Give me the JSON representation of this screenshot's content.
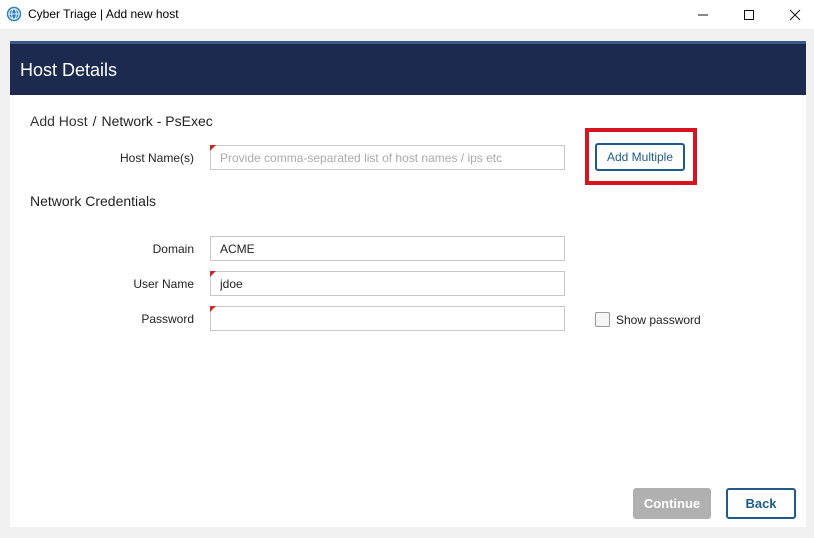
{
  "window": {
    "title": "Cyber Triage | Add new host",
    "minimize_glyph": "—",
    "maximize_glyph": "☐",
    "close_glyph": "✕"
  },
  "header": {
    "title": "Host Details"
  },
  "breadcrumb": {
    "parent": "Add Host",
    "separator": "/",
    "current": "Network - PsExec"
  },
  "form": {
    "host_names": {
      "label": "Host Name(s)",
      "value": "",
      "placeholder": "Provide comma-separated list of host names / ips etc",
      "required": true
    },
    "add_multiple_label": "Add Multiple",
    "credentials_title": "Network Credentials",
    "domain": {
      "label": "Domain",
      "value": "ACME",
      "required": false
    },
    "username": {
      "label": "User Name",
      "value": "jdoe",
      "required": true
    },
    "password": {
      "label": "Password",
      "value": "",
      "required": true
    },
    "show_password": {
      "label": "Show password",
      "checked": false
    }
  },
  "actions": {
    "continue_label": "Continue",
    "continue_enabled": false,
    "back_label": "Back"
  },
  "colors": {
    "header_bg": "#1b2a4e",
    "accent": "#1f5a8a",
    "highlight": "#d9141e",
    "required_marker": "#d0262b",
    "disabled_button": "#b0b0b0"
  },
  "icons": {
    "app": "cyber-triage-globe-icon",
    "checkbox": "checkbox-icon"
  }
}
